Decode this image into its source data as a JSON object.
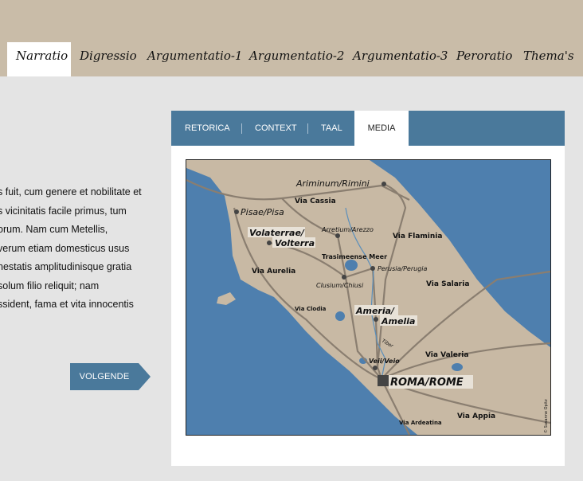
{
  "nav": {
    "tabs": [
      {
        "label": "Narratio",
        "active": true
      },
      {
        "label": "Digressio"
      },
      {
        "label": "Argumentatio-1"
      },
      {
        "label": "Argumentatio-2"
      },
      {
        "label": "Argumentatio-3"
      },
      {
        "label": "Peroratio"
      },
      {
        "label": "Thema's"
      }
    ]
  },
  "body": {
    "lines": [
      "s fuit, cum genere et nobilitate et",
      "s vicinitatis facile primus, tum",
      "orum. Nam cum Metellis,",
      " verum etiam domesticus usus",
      "nestatis amplitudinisque gratia",
      "solum filio reliquit; nam",
      "ssident, fama et vita innocentis"
    ],
    "next_label": "VOLGENDE"
  },
  "panel": {
    "tabs": [
      {
        "label": "RETORICA"
      },
      {
        "label": "CONTEXT"
      },
      {
        "label": "TAAL"
      },
      {
        "label": "MEDIA",
        "active": true
      }
    ]
  },
  "map": {
    "labels": {
      "rimini": "Ariminum/Rimini",
      "cassia": "Via Cassia",
      "pisa": "Pisae/Pisa",
      "volaterrae": "Volaterrae/",
      "volterra": "Volterra",
      "arezzo": "Arretium/Arezzo",
      "flaminia": "Via Flaminia",
      "trasimeno": "Trasimeense Meer",
      "perugia": "Perusia/Perugia",
      "aurelia": "Via Aurelia",
      "chiusi": "Clusium/Chiusi",
      "salaria": "Via Salaria",
      "clodia": "Via Clodia",
      "ameria": "Ameria/",
      "amelia": "Amelia",
      "tiber": "Tiber",
      "valeria": "Via Valeria",
      "veio": "Veii/Veio",
      "roma": "ROMA/ROME",
      "appia": "Via Appia",
      "ardeatina": "Via Ardeatina",
      "credit": "© Susanne Opitz"
    }
  },
  "colors": {
    "accent": "#4a799b",
    "topbar": "#c9bca8",
    "sea": "#4e7fae",
    "land": "#c8b9a4"
  }
}
